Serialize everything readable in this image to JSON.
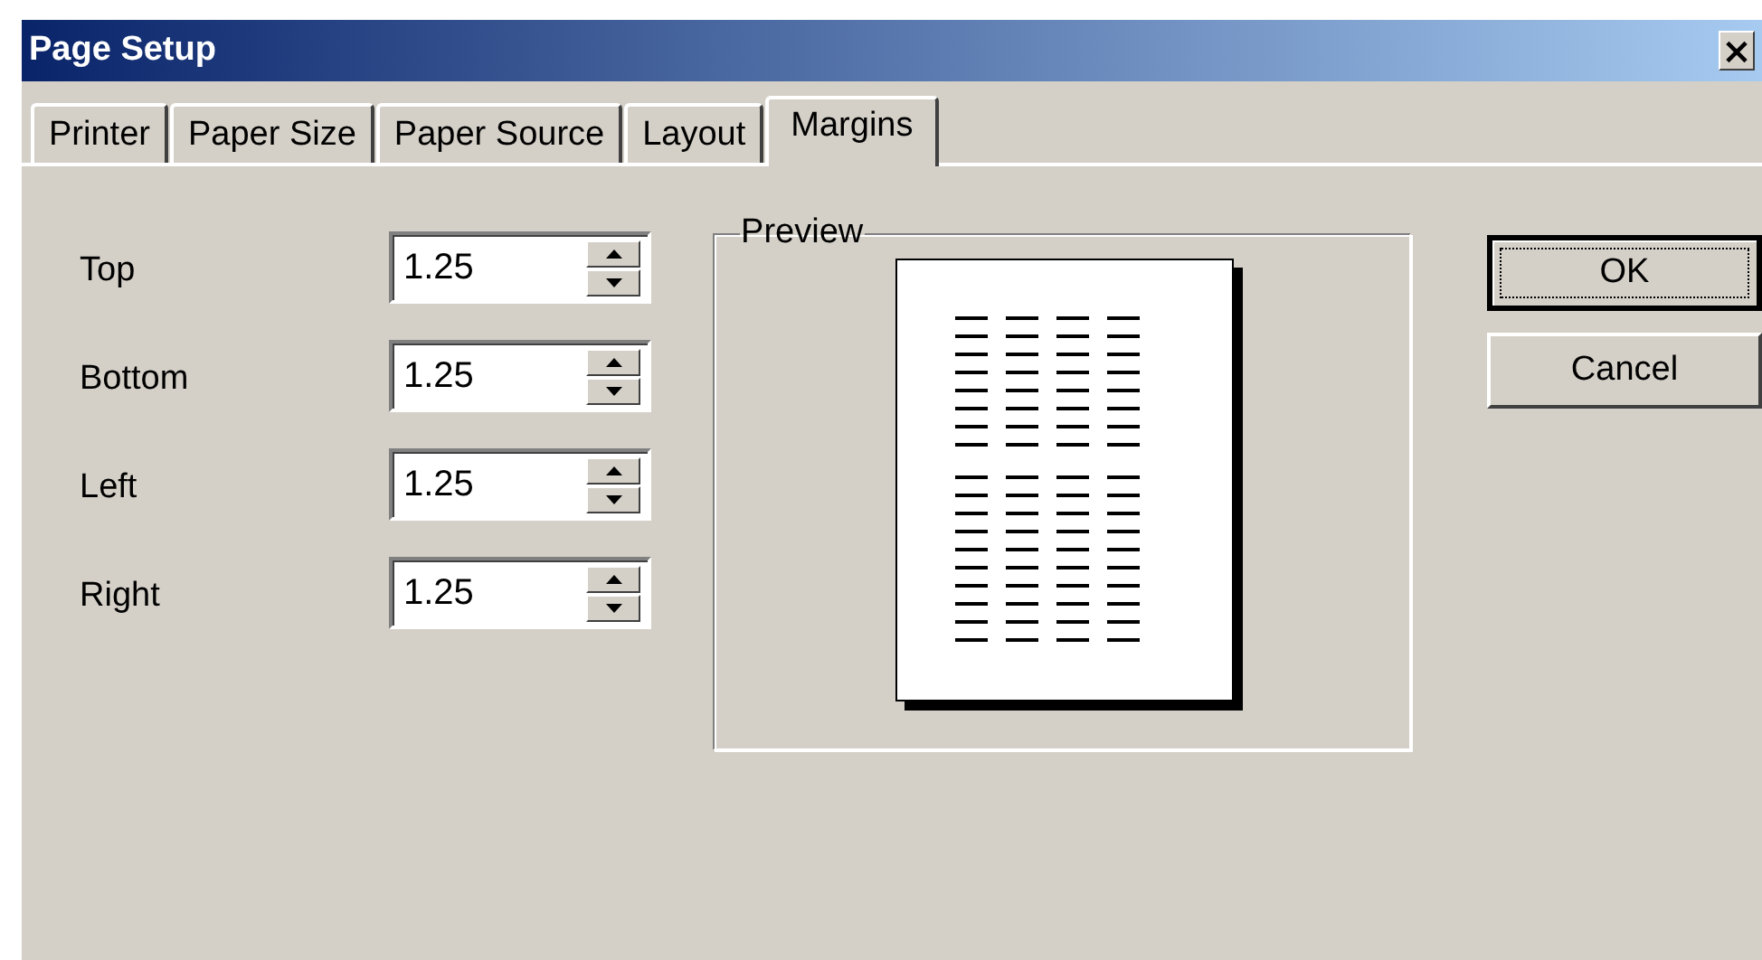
{
  "window": {
    "title": "Page Setup",
    "close": "×"
  },
  "tabs": [
    {
      "label": "Printer",
      "selected": false
    },
    {
      "label": "Paper Size",
      "selected": false
    },
    {
      "label": "Paper Source",
      "selected": false
    },
    {
      "label": "Layout",
      "selected": false
    },
    {
      "label": "Margins",
      "selected": true
    }
  ],
  "margins": [
    {
      "label": "Top",
      "value": "1.25"
    },
    {
      "label": "Bottom",
      "value": "1.25"
    },
    {
      "label": "Left",
      "value": "1.25"
    },
    {
      "label": "Right",
      "value": "1.25"
    }
  ],
  "preview": {
    "title": "Preview"
  },
  "buttons": [
    {
      "label": "OK",
      "focused": true
    },
    {
      "label": "Cancel",
      "focused": false
    }
  ]
}
